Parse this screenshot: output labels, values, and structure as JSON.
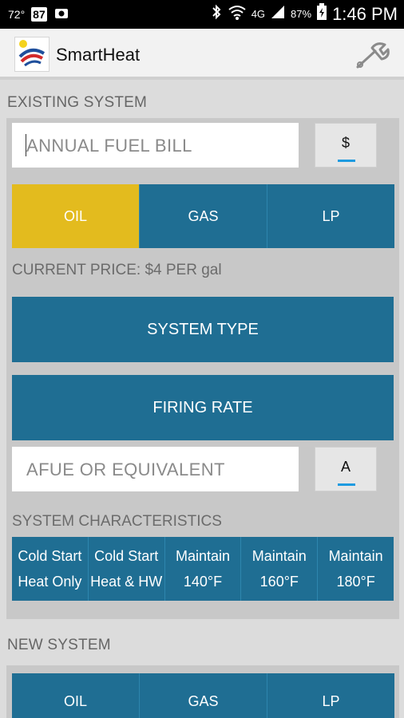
{
  "status_bar": {
    "temperature": "72°",
    "badge": "87",
    "network": "4G",
    "battery": "87%",
    "time": "1:46 PM"
  },
  "app": {
    "title": "SmartHeat"
  },
  "existing": {
    "section_title": "EXISTING SYSTEM",
    "fuel_bill_placeholder": "ANNUAL FUEL BILL",
    "bill_unit_button": "$",
    "fuel_options": [
      "OIL",
      "GAS",
      "LP"
    ],
    "selected_fuel": "OIL",
    "current_price": "CURRENT PRICE: $4 PER gal",
    "system_type_button": "SYSTEM TYPE",
    "firing_rate_button": "FIRING RATE",
    "afue_placeholder": "AFUE OR EQUIVALENT",
    "afue_button": "A",
    "characteristics_title": "SYSTEM CHARACTERISTICS",
    "characteristics": [
      {
        "line1": "Cold Start",
        "line2": "Heat Only"
      },
      {
        "line1": "Cold Start",
        "line2": "Heat & HW"
      },
      {
        "line1": "Maintain",
        "line2": "140°F"
      },
      {
        "line1": "Maintain",
        "line2": "160°F"
      },
      {
        "line1": "Maintain",
        "line2": "180°F"
      }
    ]
  },
  "new_system": {
    "section_title": "NEW SYSTEM",
    "fuel_options": [
      "OIL",
      "GAS",
      "LP"
    ]
  },
  "colors": {
    "primary": "#1f6e93",
    "selected": "#e3bb1e",
    "accent_underline": "#1e9be0"
  }
}
